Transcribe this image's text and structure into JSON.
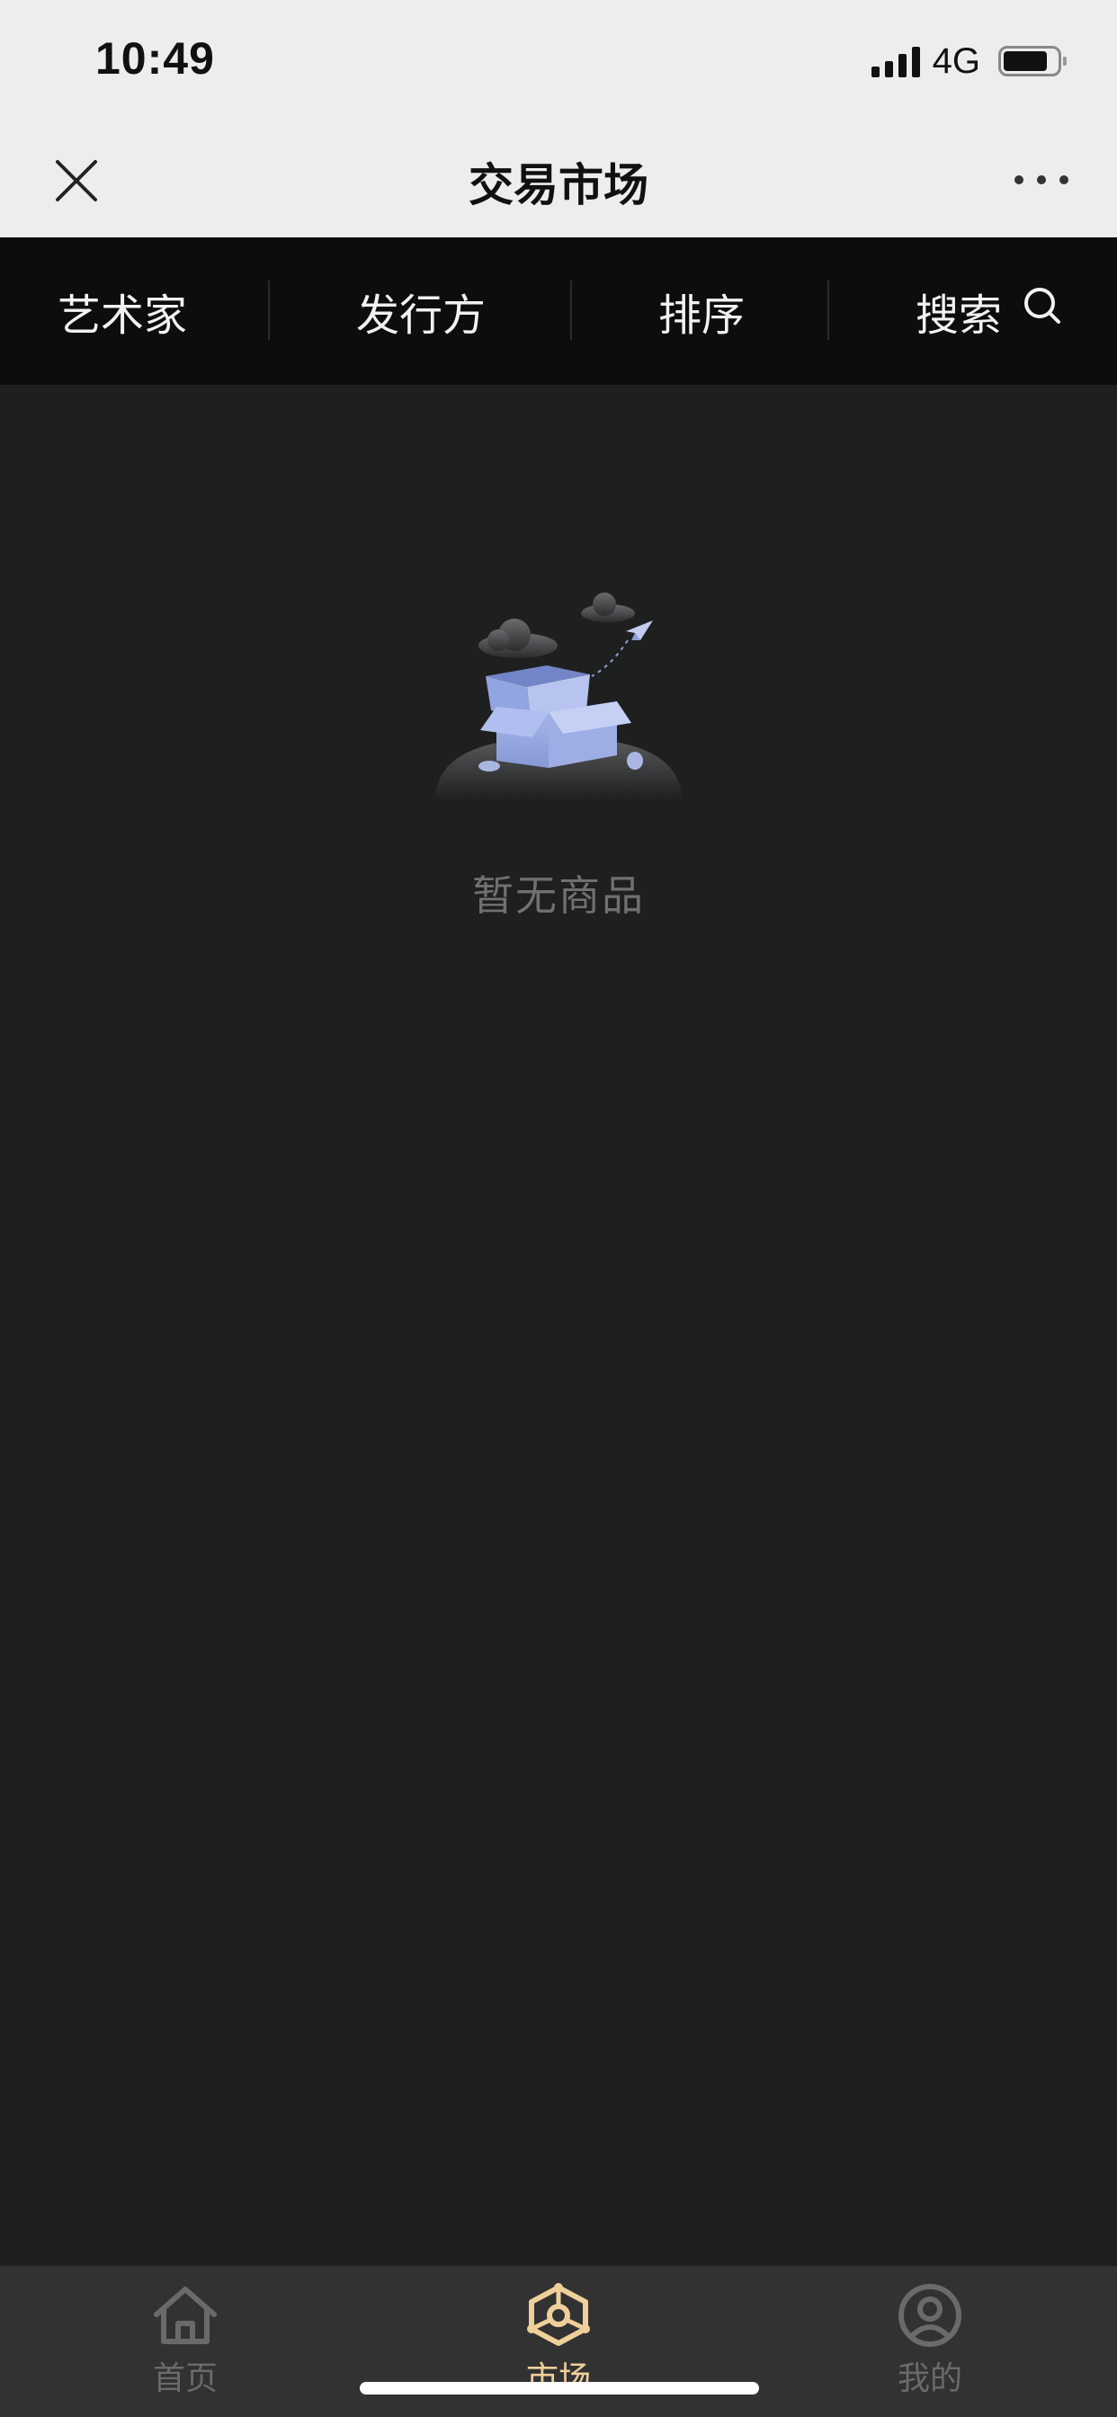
{
  "status_bar": {
    "time": "10:49",
    "network": "4G",
    "icons": [
      "signal-icon",
      "battery-icon"
    ]
  },
  "nav_bar": {
    "title": "交易市场",
    "close_icon": "close-icon",
    "more_icon": "more-icon"
  },
  "filters": [
    {
      "label": "艺术家"
    },
    {
      "label": "发行方"
    },
    {
      "label": "排序"
    },
    {
      "label": "搜索",
      "icon": "search-icon"
    }
  ],
  "empty_state": {
    "message": "暂无商品",
    "illustration": "empty-box-illustration"
  },
  "tab_bar": {
    "items": [
      {
        "label": "首页",
        "icon": "home-icon",
        "active": false
      },
      {
        "label": "市场",
        "icon": "market-icon",
        "active": true
      },
      {
        "label": "我的",
        "icon": "profile-icon",
        "active": false
      }
    ],
    "active_color": "#efd09b",
    "inactive_color": "#6a6a6b"
  },
  "colors": {
    "background": "#1e1f1f",
    "filter_bar": "#0c0d0d",
    "header": "#ededed"
  }
}
